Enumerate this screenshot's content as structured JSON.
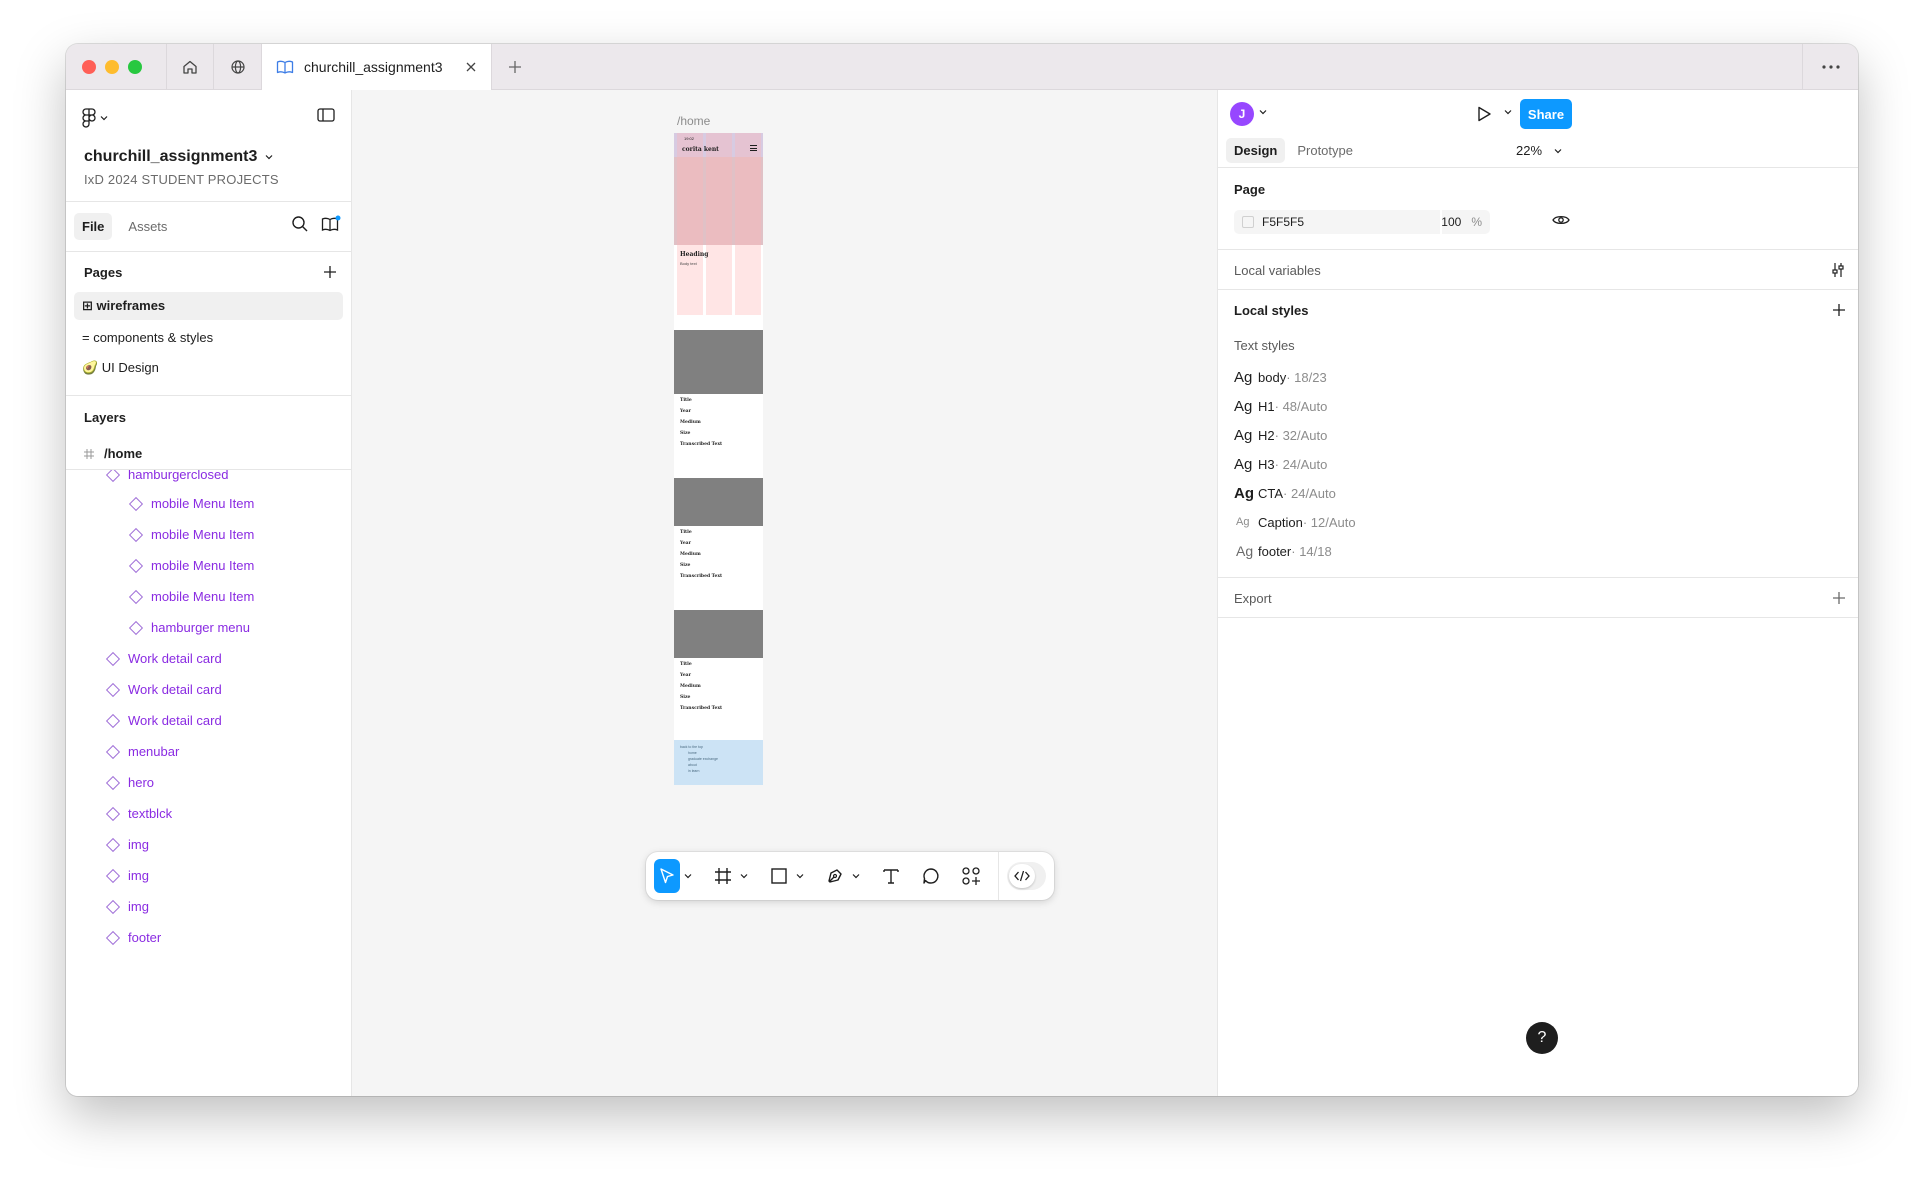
{
  "window": {
    "tab_title": "churchill_assignment3"
  },
  "left_panel": {
    "file_name": "churchill_assignment3",
    "project_name": "IxD 2024 STUDENT PROJECTS",
    "tabs": [
      "File",
      "Assets"
    ],
    "pages_title": "Pages",
    "pages": [
      {
        "label": "⊞ wireframes",
        "active": true
      },
      {
        "label": "= components & styles",
        "active": false
      },
      {
        "label": "🥑 UI Design",
        "active": false
      }
    ],
    "layers_title": "Layers",
    "root_layer": "/home",
    "layers": [
      {
        "label": "hamburgerclosed",
        "depth": 1
      },
      {
        "label": "mobile Menu Item",
        "depth": 2
      },
      {
        "label": "mobile Menu Item",
        "depth": 2
      },
      {
        "label": "mobile Menu Item",
        "depth": 2
      },
      {
        "label": "mobile Menu Item",
        "depth": 2
      },
      {
        "label": "hamburger menu",
        "depth": 2
      },
      {
        "label": "Work detail card",
        "depth": 1
      },
      {
        "label": "Work detail card",
        "depth": 1
      },
      {
        "label": "Work detail card",
        "depth": 1
      },
      {
        "label": "menubar",
        "depth": 1
      },
      {
        "label": "hero",
        "depth": 1
      },
      {
        "label": "textblck",
        "depth": 1
      },
      {
        "label": "img",
        "depth": 1
      },
      {
        "label": "img",
        "depth": 1
      },
      {
        "label": "img",
        "depth": 1
      },
      {
        "label": "footer",
        "depth": 1
      }
    ]
  },
  "canvas": {
    "frame_label": "/home",
    "frame": {
      "time": "19:02",
      "brand": "corita kent",
      "heading": "Heading",
      "body": "Body text",
      "card_fields": [
        "Title",
        "Year",
        "Medium",
        "Size",
        "Transcribed Text"
      ],
      "footer_lines": [
        "back to the top",
        "home",
        "graduate exchange",
        "about",
        "in learn"
      ]
    }
  },
  "toolbar": {
    "tools": [
      "move-tool",
      "frame-tool",
      "rectangle-tool",
      "pen-tool",
      "text-tool",
      "comment-tool",
      "actions-tool"
    ]
  },
  "right_panel": {
    "avatar_initial": "J",
    "share_label": "Share",
    "tabs": [
      "Design",
      "Prototype"
    ],
    "zoom": "22%",
    "page_section": {
      "title": "Page",
      "color_hex": "F5F5F5",
      "opacity": "100",
      "opacity_unit": "%"
    },
    "local_variables_title": "Local variables",
    "local_styles_title": "Local styles",
    "text_styles_title": "Text styles",
    "text_styles": [
      {
        "name": "body",
        "value": " · 18/23",
        "weight": "normal"
      },
      {
        "name": "H1",
        "value": " · 48/Auto",
        "weight": "normal"
      },
      {
        "name": "H2",
        "value": " · 32/Auto",
        "weight": "normal"
      },
      {
        "name": "H3",
        "value": " · 24/Auto",
        "weight": "normal"
      },
      {
        "name": "CTA",
        "value": " · 24/Auto",
        "weight": "bold"
      },
      {
        "name": "Caption",
        "value": " · 12/Auto",
        "weight": "small"
      },
      {
        "name": "footer",
        "value": " · 14/18",
        "weight": "muted"
      }
    ],
    "ag_glyph": "Ag",
    "export_title": "Export",
    "help_label": "?"
  },
  "colors": {
    "accent": "#0d99ff",
    "layer_purple": "#8a2be2",
    "avatar": "#9747ff",
    "hero_pink": "#e0c1c6",
    "menubar_lilac": "#d7cbe2",
    "image_gray": "#808080",
    "footer_blue": "#cce3f5",
    "canvas_bg": "#f5f5f5"
  }
}
